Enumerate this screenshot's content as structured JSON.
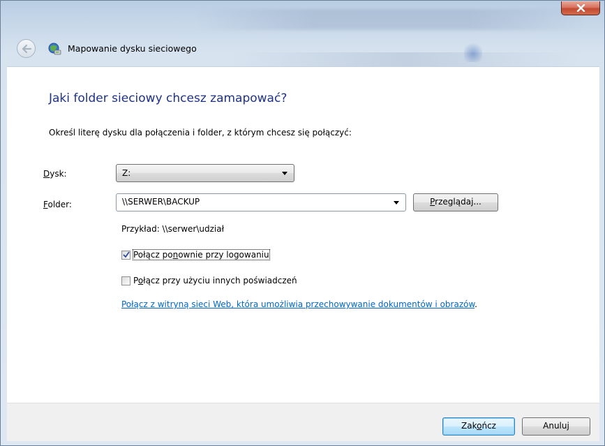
{
  "window": {
    "title": "Mapowanie dysku sieciowego",
    "close_label": "x"
  },
  "page": {
    "heading": "Jaki folder sieciowy chcesz zamapować?",
    "intro": "Określ literę dysku dla połączenia i folder, z którym chcesz się połączyć:"
  },
  "drive": {
    "label_mnemonic": "D",
    "label_rest": "ysk:",
    "value": "Z:"
  },
  "folder": {
    "label_mnemonic": "F",
    "label_rest": "older:",
    "value": "\\\\SERWER\\BACKUP",
    "browse_pre": "",
    "browse_mnemonic": "P",
    "browse_post": "rzeglądaj..."
  },
  "example": "Przykład: \\\\serwer\\udział",
  "options": {
    "reconnect_pre": "Połącz po",
    "reconnect_mnemonic": "n",
    "reconnect_post": "ownie przy logowaniu",
    "reconnect_checked": true,
    "other_creds_pre": "P",
    "other_creds_mnemonic": "o",
    "other_creds_post": "łącz przy użyciu innych poświadczeń",
    "other_creds_checked": false
  },
  "link": {
    "text": "Połącz z witryną sieci Web, która umożliwia przechowywanie dokumentów i obrazów",
    "suffix": "."
  },
  "footer": {
    "finish_pre": "Zak",
    "finish_mnemonic": "o",
    "finish_post": "ńcz",
    "cancel": "Anuluj"
  },
  "colors": {
    "heading": "#1e3287",
    "link": "#0066cc",
    "close": "#c24a32"
  },
  "icons": {
    "back": "back-arrow-icon",
    "title": "network-drive-icon",
    "close": "close-icon"
  }
}
